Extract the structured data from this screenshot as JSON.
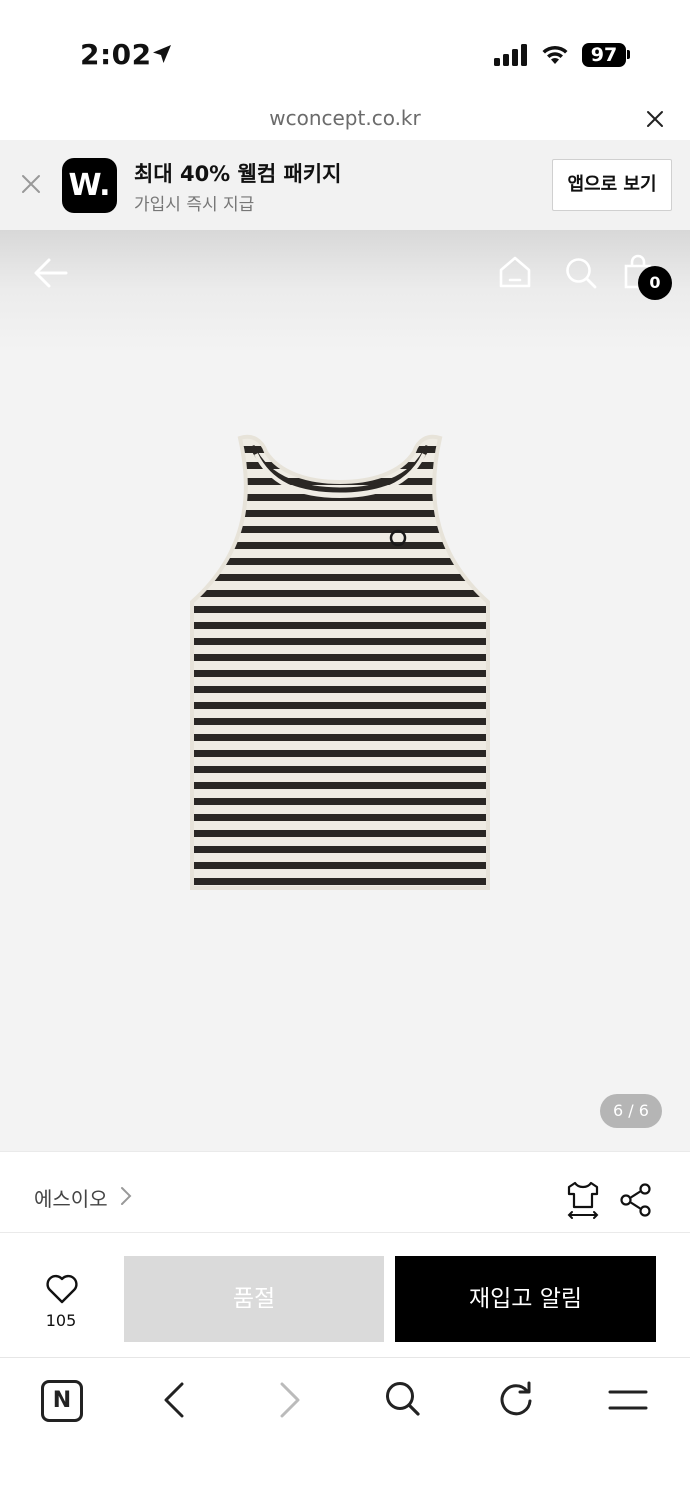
{
  "status_bar": {
    "time": "2:02",
    "battery": "97"
  },
  "browser": {
    "url": "wconcept.co.kr"
  },
  "banner": {
    "logo_text": "W.",
    "title": "최대 40% 웰컴 패키지",
    "subtitle": "가입시 즉시 지급",
    "open_app_label": "앱으로 보기"
  },
  "product_header": {
    "cart_count": "0"
  },
  "gallery": {
    "pager": "6 / 6"
  },
  "brand": {
    "name": "에스이오"
  },
  "actions": {
    "like_count": "105",
    "soldout_label": "품절",
    "restock_label": "재입고 알림"
  },
  "toolbar": {
    "home_label": "N"
  },
  "icons": [
    "location-arrow-icon",
    "signal-icon",
    "wifi-icon",
    "close-icon",
    "arrow-left-icon",
    "home-icon",
    "search-icon",
    "shopping-bag-icon",
    "chevron-right-icon",
    "size-guide-icon",
    "share-icon",
    "heart-icon",
    "chevron-left-icon",
    "reload-icon",
    "menu-icon"
  ]
}
